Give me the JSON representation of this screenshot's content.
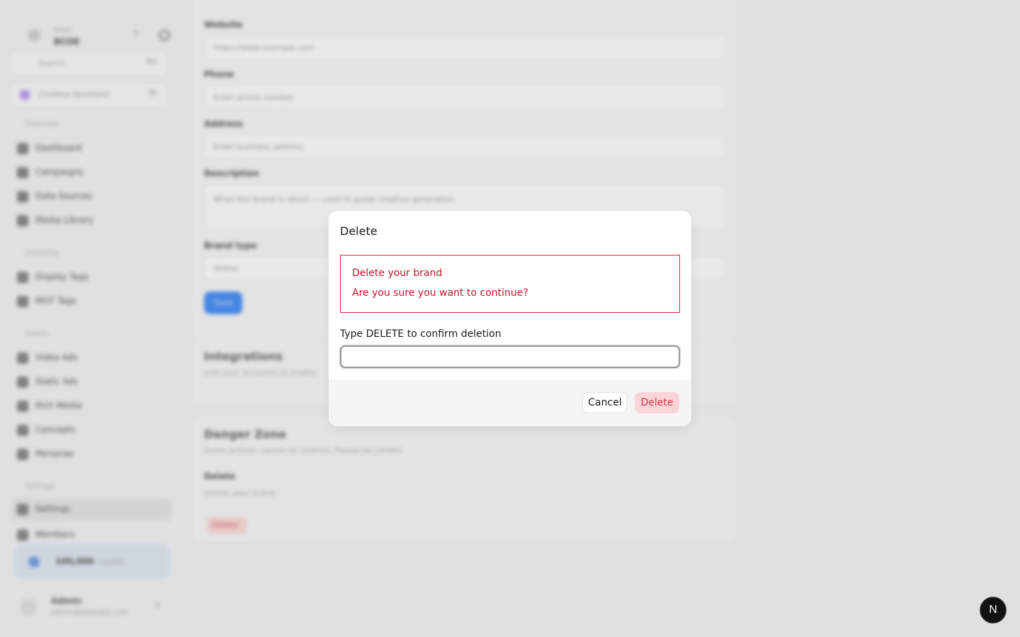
{
  "sidebar": {
    "brand_small": "Select",
    "brand_name": "BCOE",
    "search_placeholder": "Search...",
    "search_shortcut": "⌘K",
    "create_label": "Creative Assistant",
    "create_shortcut": "⌘I",
    "groups": [
      {
        "title": "Overview",
        "items": [
          "Dashboard",
          "Campaigns",
          "Data Sources",
          "Media Library"
        ]
      },
      {
        "title": "Archiving",
        "items": [
          "Display Tags",
          "MOT Tags"
        ]
      },
      {
        "title": "Assets",
        "items": [
          "Video Ads",
          "Static Ads",
          "Rich Media",
          "Concepts",
          "Personas"
        ]
      },
      {
        "title": "Settings",
        "items": [
          "Settings",
          "Members"
        ]
      }
    ],
    "credits_value": "100,000",
    "credits_unit": "credits",
    "user_name": "Admin",
    "user_email": "admin@example.com"
  },
  "main": {
    "website_label": "Website",
    "website_value": "https://www.example.com",
    "phone_label": "Phone",
    "phone_placeholder": "Enter phone number",
    "address_label": "Address",
    "address_placeholder": "Enter business address",
    "description_label": "Description",
    "description_placeholder": "What this brand is about — used to guide creative generation",
    "brand_type_label": "Brand type",
    "brand_type_value": "Online",
    "save_label": "Save",
    "integrations_title": "Integrations",
    "integrations_sub": "Link your accounts to enable",
    "danger_title": "Danger Zone",
    "danger_sub": "Some actions cannot be undone. Please be careful.",
    "delete_section_title": "Delete",
    "delete_section_sub": "Delete your brand",
    "delete_section_button": "Delete"
  },
  "modal": {
    "title": "Delete",
    "alert_title": "Delete your brand",
    "alert_message": "Are you sure you want to continue?",
    "confirm_label": "Type DELETE to confirm deletion",
    "confirm_value": "",
    "cancel_label": "Cancel",
    "delete_label": "Delete"
  },
  "badge": {
    "letter": "N"
  },
  "colors": {
    "danger": "#c4162b",
    "danger_button_bg": "#fad4d8",
    "primary": "#4a8ef2"
  }
}
